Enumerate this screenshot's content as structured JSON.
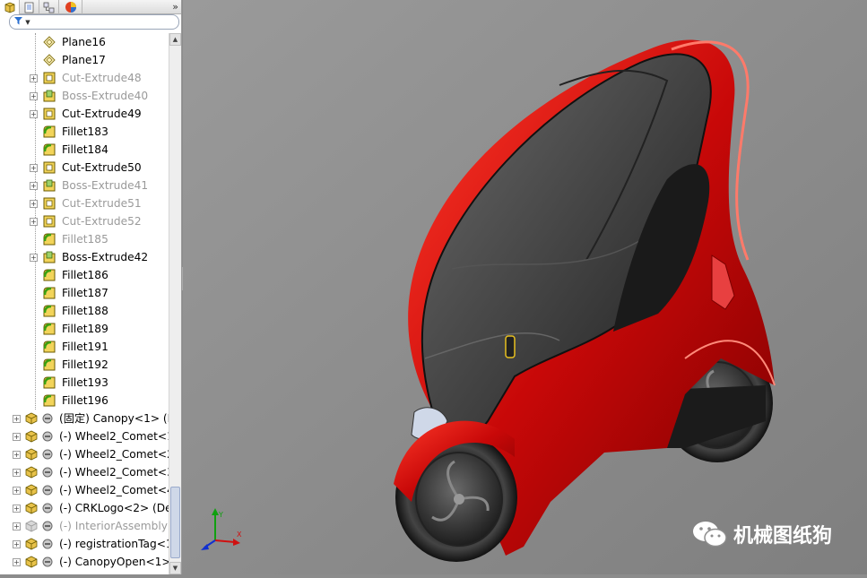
{
  "panel": {
    "tabs": [
      "feature-manager",
      "property-manager",
      "configuration-manager",
      "display-manager"
    ],
    "expand_chevron": "»",
    "filter_icon": "funnel-icon",
    "tree_items": [
      {
        "label": "Plane16",
        "icon": "plane-icon",
        "state": "normal",
        "expandable": false
      },
      {
        "label": "Plane17",
        "icon": "plane-icon",
        "state": "normal",
        "expandable": false
      },
      {
        "label": "Cut-Extrude48",
        "icon": "cut-extrude-icon",
        "state": "suppressed",
        "expandable": true
      },
      {
        "label": "Boss-Extrude40",
        "icon": "boss-extrude-icon",
        "state": "suppressed",
        "expandable": true
      },
      {
        "label": "Cut-Extrude49",
        "icon": "cut-extrude-icon",
        "state": "normal",
        "expandable": true
      },
      {
        "label": "Fillet183",
        "icon": "fillet-icon",
        "state": "normal",
        "expandable": false
      },
      {
        "label": "Fillet184",
        "icon": "fillet-icon",
        "state": "normal",
        "expandable": false
      },
      {
        "label": "Cut-Extrude50",
        "icon": "cut-extrude-icon",
        "state": "normal",
        "expandable": true
      },
      {
        "label": "Boss-Extrude41",
        "icon": "boss-extrude-icon",
        "state": "suppressed",
        "expandable": true
      },
      {
        "label": "Cut-Extrude51",
        "icon": "cut-extrude-icon",
        "state": "suppressed",
        "expandable": true
      },
      {
        "label": "Cut-Extrude52",
        "icon": "cut-extrude-icon",
        "state": "suppressed",
        "expandable": true
      },
      {
        "label": "Fillet185",
        "icon": "fillet-icon",
        "state": "suppressed",
        "expandable": false
      },
      {
        "label": "Boss-Extrude42",
        "icon": "boss-extrude-icon",
        "state": "normal",
        "expandable": true
      },
      {
        "label": "Fillet186",
        "icon": "fillet-icon",
        "state": "normal",
        "expandable": false
      },
      {
        "label": "Fillet187",
        "icon": "fillet-icon",
        "state": "normal",
        "expandable": false
      },
      {
        "label": "Fillet188",
        "icon": "fillet-icon",
        "state": "normal",
        "expandable": false
      },
      {
        "label": "Fillet189",
        "icon": "fillet-icon",
        "state": "normal",
        "expandable": false
      },
      {
        "label": "Fillet191",
        "icon": "fillet-icon",
        "state": "normal",
        "expandable": false
      },
      {
        "label": "Fillet192",
        "icon": "fillet-icon",
        "state": "normal",
        "expandable": false
      },
      {
        "label": "Fillet193",
        "icon": "fillet-icon",
        "state": "normal",
        "expandable": false
      },
      {
        "label": "Fillet196",
        "icon": "fillet-icon",
        "state": "normal",
        "expandable": false
      },
      {
        "label": "(固定) Canopy<1> (D",
        "icon": "part-icon",
        "state": "normal",
        "expandable": true
      },
      {
        "label": "(-) Wheel2_Comet<1",
        "icon": "part-icon",
        "state": "normal",
        "expandable": true
      },
      {
        "label": "(-) Wheel2_Comet<2",
        "icon": "part-icon",
        "state": "normal",
        "expandable": true
      },
      {
        "label": "(-) Wheel2_Comet<3",
        "icon": "part-icon",
        "state": "normal",
        "expandable": true
      },
      {
        "label": "(-) Wheel2_Comet<4",
        "icon": "part-icon",
        "state": "normal",
        "expandable": true
      },
      {
        "label": "(-) CRKLogo<2> (De",
        "icon": "part-icon",
        "state": "normal",
        "expandable": true
      },
      {
        "label": "(-) InteriorAssembly<1>",
        "icon": "assembly-icon",
        "state": "suppressed",
        "expandable": false
      },
      {
        "label": "(-) registrationTag<1",
        "icon": "part-icon",
        "state": "normal",
        "expandable": true
      },
      {
        "label": "(-) CanopyOpen<1>",
        "icon": "part-icon",
        "state": "normal",
        "expandable": true
      }
    ]
  },
  "viewport": {
    "triad_axes": [
      "x-axis",
      "y-axis",
      "z-axis"
    ],
    "model": "car-model",
    "body_color": "#d40a0a",
    "background_color": "#8d8d8d"
  },
  "watermark": {
    "text": "机械图纸狗",
    "icon": "wechat-icon"
  }
}
